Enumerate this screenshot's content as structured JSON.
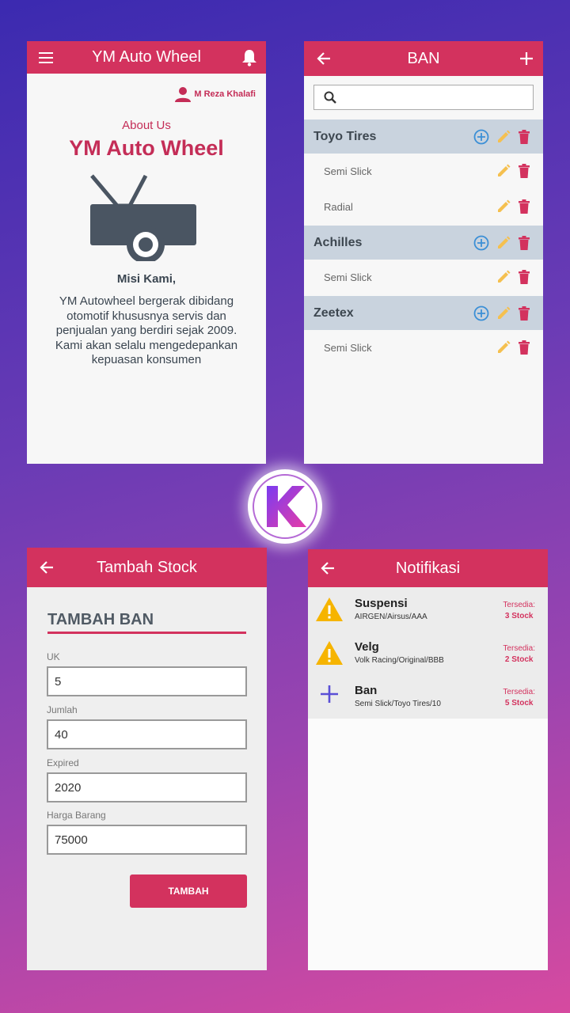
{
  "screen1": {
    "app_title": "YM Auto Wheel",
    "user_name": "M Reza Khalafi",
    "about_label": "About Us",
    "about_title": "YM Auto Wheel",
    "mission_heading": "Misi Kami,",
    "mission_text": "YM Autowheel bergerak dibidang otomotif khususnya servis dan penjualan yang berdiri sejak 2009. Kami akan selalu mengedepankan kepuasan konsumen",
    "icons": [
      "menu-icon",
      "bell-icon",
      "user-icon",
      "car-icon"
    ]
  },
  "screen2": {
    "title": "BAN",
    "search_placeholder": "",
    "brands": [
      {
        "name": "Toyo Tires",
        "items": [
          "Semi Slick",
          "Radial"
        ]
      },
      {
        "name": "Achilles",
        "items": [
          "Semi Slick"
        ]
      },
      {
        "name": "Zeetex",
        "items": [
          "Semi Slick"
        ]
      }
    ],
    "icons": [
      "back-arrow-icon",
      "plus-icon",
      "search-icon",
      "add-circle-icon",
      "pencil-icon",
      "trash-icon"
    ]
  },
  "screen3": {
    "title": "Tambah Stock",
    "form_title": "TAMBAH BAN",
    "fields": [
      {
        "label": "UK",
        "value": "5"
      },
      {
        "label": "Jumlah",
        "value": "40"
      },
      {
        "label": "Expired",
        "value": "2020"
      },
      {
        "label": "Harga Barang",
        "value": "75000"
      }
    ],
    "submit_label": "TAMBAH"
  },
  "screen4": {
    "title": "Notifikasi",
    "notifications": [
      {
        "title": "Suspensi",
        "detail": "AIRGEN/Airsus/AAA",
        "avail_label": "Tersedia:",
        "stock": "3 Stock",
        "icon": "warning-icon"
      },
      {
        "title": "Velg",
        "detail": "Volk Racing/Original/BBB",
        "avail_label": "Tersedia:",
        "stock": "2 Stock",
        "icon": "warning-icon"
      },
      {
        "title": "Ban",
        "detail": "Semi Slick/Toyo Tires/10",
        "avail_label": "Tersedia:",
        "stock": "5 Stock",
        "icon": "plus-icon"
      }
    ]
  },
  "logo": {
    "letter": "K"
  },
  "colors": {
    "primary": "#d3325e",
    "brand_row": "#c9d3de",
    "accent_blue": "#3b8fd6",
    "accent_yellow": "#f5c04f",
    "warning": "#f6b400",
    "plus_purple": "#5a4fd6"
  }
}
